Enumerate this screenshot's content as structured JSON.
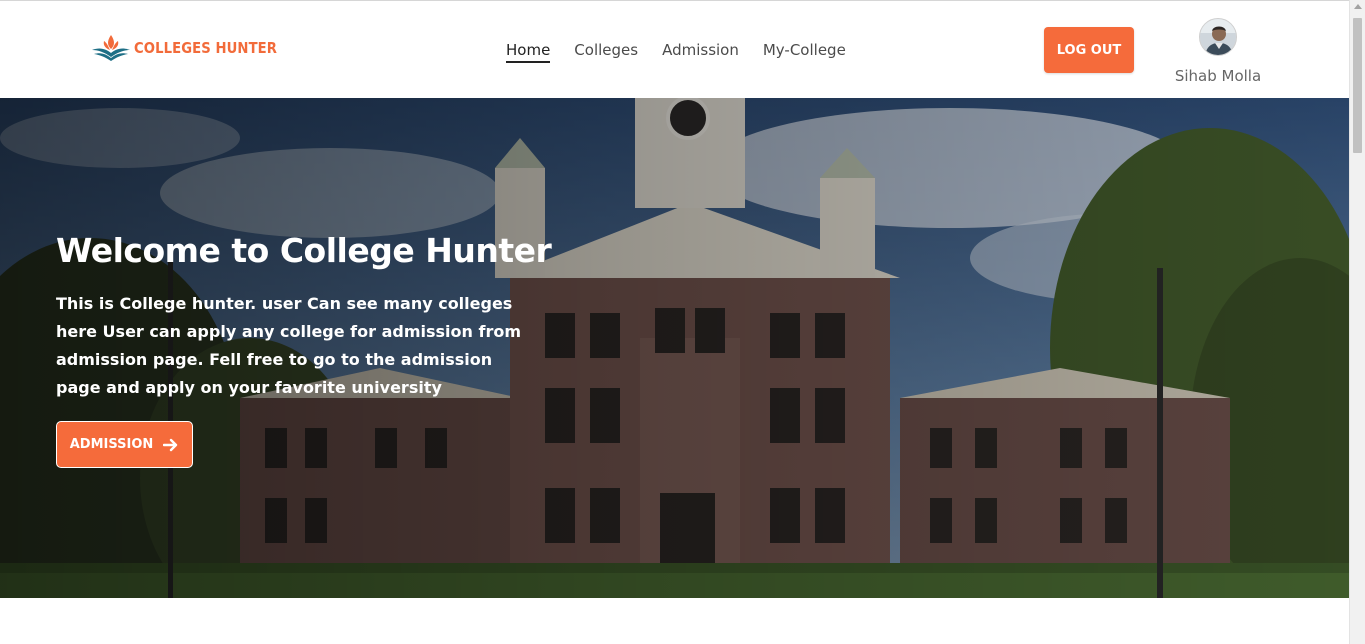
{
  "brand": {
    "logo_text": "COLLEGES HUNTER",
    "accent_color": "#f56b3b",
    "logo_icon": "lotus-book-icon"
  },
  "nav": {
    "items": [
      {
        "label": "Home",
        "active": true
      },
      {
        "label": "Colleges",
        "active": false
      },
      {
        "label": "Admission",
        "active": false
      },
      {
        "label": "My-College",
        "active": false
      }
    ]
  },
  "user": {
    "logout_label": "LOG OUT",
    "name": "Sihab Molla",
    "avatar_icon": "user-avatar"
  },
  "hero": {
    "title": "Welcome to College Hunter",
    "description": "This is College hunter. user Can see many colleges here User can apply any college for admission from admission page. Fell free to go to the admission page and apply on your favorite university",
    "button_label": "ADMISSION",
    "button_icon": "arrow-right-icon",
    "background": "college-building-photo"
  }
}
